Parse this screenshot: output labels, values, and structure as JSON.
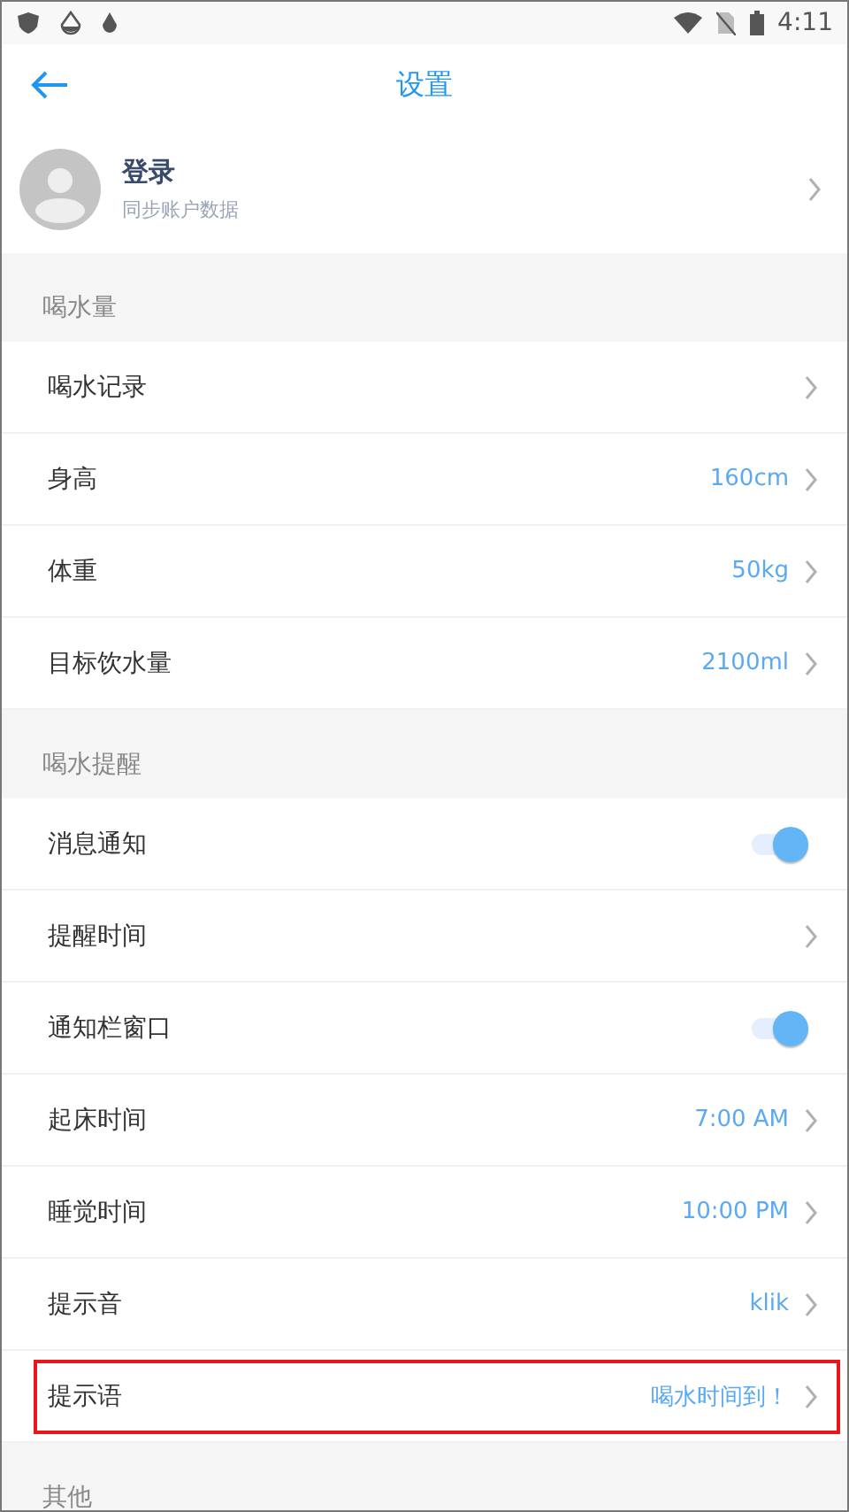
{
  "status_bar": {
    "time": "4:11"
  },
  "header": {
    "title": "设置"
  },
  "profile": {
    "name": "登录",
    "subtitle": "同步账户数据"
  },
  "sections": [
    {
      "title": "喝水量",
      "rows": [
        {
          "kind": "link",
          "label": "喝水记录",
          "highlighted": false
        },
        {
          "kind": "link",
          "label": "身高",
          "value": "160cm",
          "highlighted": false
        },
        {
          "kind": "link",
          "label": "体重",
          "value": "50kg",
          "highlighted": false
        },
        {
          "kind": "link",
          "label": "目标饮水量",
          "value": "2100ml",
          "highlighted": false
        }
      ]
    },
    {
      "title": "喝水提醒",
      "rows": [
        {
          "kind": "toggle",
          "label": "消息通知",
          "on": true,
          "highlighted": false
        },
        {
          "kind": "link",
          "label": "提醒时间",
          "highlighted": false
        },
        {
          "kind": "toggle",
          "label": "通知栏窗口",
          "on": true,
          "highlighted": false
        },
        {
          "kind": "link",
          "label": "起床时间",
          "value": "7:00 AM",
          "highlighted": false
        },
        {
          "kind": "link",
          "label": "睡觉时间",
          "value": "10:00 PM",
          "highlighted": false
        },
        {
          "kind": "link",
          "label": "提示音",
          "value": "klik",
          "highlighted": false
        },
        {
          "kind": "link",
          "label": "提示语",
          "value": "喝水时间到！",
          "highlighted": true
        }
      ]
    },
    {
      "title": "其他"
    }
  ]
}
